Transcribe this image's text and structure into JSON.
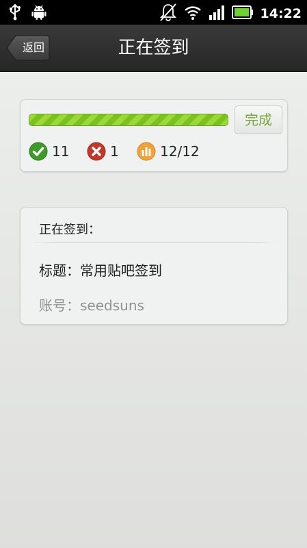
{
  "status_bar": {
    "time": "14:22",
    "left_icons": [
      "usb-icon",
      "android-debug-icon"
    ],
    "right_icons": [
      "alarm-off-icon",
      "wifi-icon",
      "signal-icon",
      "battery-icon"
    ]
  },
  "header": {
    "back_label": "返回",
    "title": "正在签到"
  },
  "progress_card": {
    "progress": 1.0,
    "done_label": "完成",
    "success_count": "11",
    "fail_count": "1",
    "total": "12/12"
  },
  "detail_card": {
    "header": "正在签到：",
    "title_line": "标题：常用贴吧签到",
    "account_line": "账号：seedsuns"
  },
  "colors": {
    "accent_green": "#7cc21f",
    "success": "#3e9b2a",
    "fail": "#c0392b",
    "total": "#f0a23a"
  }
}
